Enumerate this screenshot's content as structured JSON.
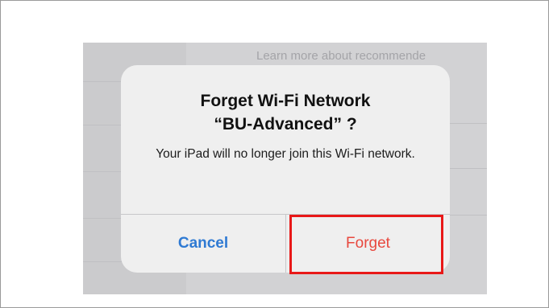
{
  "background": {
    "hint_text": "Learn more about recommende"
  },
  "alert": {
    "title_line1": "Forget Wi-Fi Network",
    "title_line2": "“BU-Advanced” ?",
    "message": "Your iPad will no longer join this Wi-Fi network.",
    "cancel_label": "Cancel",
    "forget_label": "Forget"
  },
  "colors": {
    "cancel_text": "#2f7ad3",
    "destructive_text": "#e8483e",
    "highlight_border": "#e81818",
    "alert_background": "#efefef"
  }
}
